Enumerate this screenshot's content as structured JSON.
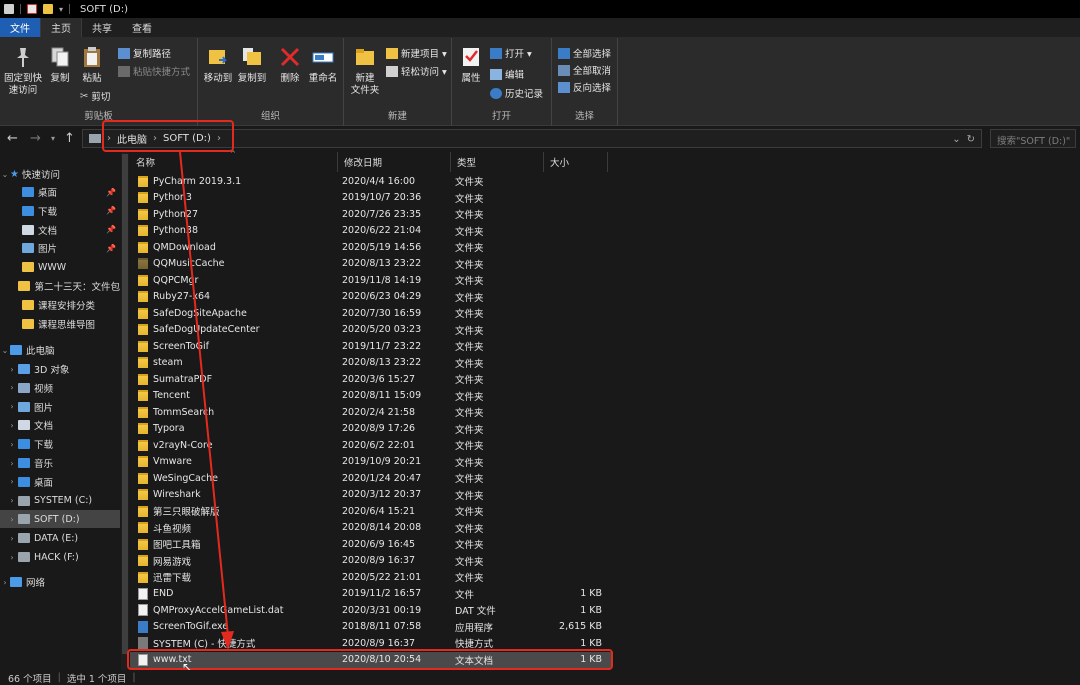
{
  "window": {
    "title": "SOFT (D:)"
  },
  "tabs": [
    {
      "label": "文件"
    },
    {
      "label": "主页"
    },
    {
      "label": "共享"
    },
    {
      "label": "查看"
    }
  ],
  "ribbon": {
    "clipboard": {
      "group_label": "剪贴板",
      "pin": "固定到快\n速访问",
      "copy": "复制",
      "paste": "粘贴",
      "copy_path": "复制路径",
      "paste_shortcut": "粘贴快捷方式",
      "cut": "剪切"
    },
    "organize": {
      "group_label": "组织",
      "move_to": "移动到",
      "copy_to": "复制到",
      "delete": "删除",
      "rename": "重命名"
    },
    "new": {
      "group_label": "新建",
      "new_folder": "新建\n文件夹",
      "new_item": "新建项目 ▾",
      "easy_access": "轻松访问 ▾"
    },
    "open": {
      "group_label": "打开",
      "properties": "属性",
      "open": "打开 ▾",
      "edit": "编辑",
      "history": "历史记录"
    },
    "select": {
      "group_label": "选择",
      "select_all": "全部选择",
      "select_none": "全部取消",
      "invert": "反向选择"
    }
  },
  "address": {
    "crumbs": [
      "此电脑",
      "SOFT (D:)"
    ],
    "search_placeholder": "搜索\"SOFT (D:)\""
  },
  "sidebar": {
    "quick_access": "快速访问",
    "quick_items": [
      {
        "label": "桌面",
        "icon": "desktop-icon",
        "color": "#3d8ee0",
        "pinned": true
      },
      {
        "label": "下载",
        "icon": "download-icon",
        "color": "#3d8ee0",
        "pinned": true
      },
      {
        "label": "文档",
        "icon": "document-icon",
        "color": "#cfd8e3",
        "pinned": true
      },
      {
        "label": "图片",
        "icon": "picture-icon",
        "color": "#6fa8dc",
        "pinned": true
      },
      {
        "label": "WWW",
        "icon": "folder-icon",
        "color": "#f0c243",
        "pinned": false
      },
      {
        "label": "第二十三天：文件包",
        "icon": "folder-icon",
        "color": "#f0c243",
        "pinned": false
      },
      {
        "label": "课程安排分类",
        "icon": "folder-icon",
        "color": "#f0c243",
        "pinned": false
      },
      {
        "label": "课程思维导图",
        "icon": "folder-icon",
        "color": "#f0c243",
        "pinned": false
      }
    ],
    "this_pc": "此电脑",
    "pc_items": [
      {
        "label": "3D 对象",
        "icon": "3d-objects-icon",
        "color": "#5aa0e6"
      },
      {
        "label": "视频",
        "icon": "video-icon",
        "color": "#8aa7c7"
      },
      {
        "label": "图片",
        "icon": "picture-icon",
        "color": "#6fa8dc"
      },
      {
        "label": "文档",
        "icon": "document-icon",
        "color": "#cfd8e3"
      },
      {
        "label": "下载",
        "icon": "download-icon",
        "color": "#3d8ee0"
      },
      {
        "label": "音乐",
        "icon": "music-icon",
        "color": "#3d8ee0"
      },
      {
        "label": "桌面",
        "icon": "desktop-icon",
        "color": "#3d8ee0"
      },
      {
        "label": "SYSTEM (C:)",
        "icon": "drive-icon",
        "color": "#9aa4ad"
      },
      {
        "label": "SOFT (D:)",
        "icon": "drive-icon",
        "color": "#9aa4ad",
        "selected": true
      },
      {
        "label": "DATA (E:)",
        "icon": "drive-icon",
        "color": "#9aa4ad"
      },
      {
        "label": "HACK (F:)",
        "icon": "drive-icon",
        "color": "#9aa4ad"
      }
    ],
    "network": "网络"
  },
  "columns": {
    "name": "名称",
    "date": "修改日期",
    "type": "类型",
    "size": "大小"
  },
  "files": [
    {
      "name": "PyCharm 2019.3.1",
      "date": "2020/4/4 16:00",
      "type": "文件夹",
      "size": "",
      "kind": "folder"
    },
    {
      "name": "Python3",
      "date": "2019/10/7 20:36",
      "type": "文件夹",
      "size": "",
      "kind": "folder"
    },
    {
      "name": "Python27",
      "date": "2020/7/26 23:35",
      "type": "文件夹",
      "size": "",
      "kind": "folder"
    },
    {
      "name": "Python38",
      "date": "2020/6/22 21:04",
      "type": "文件夹",
      "size": "",
      "kind": "folder"
    },
    {
      "name": "QMDownload",
      "date": "2020/5/19 14:56",
      "type": "文件夹",
      "size": "",
      "kind": "folder"
    },
    {
      "name": "QQMusicCache",
      "date": "2020/8/13 23:22",
      "type": "文件夹",
      "size": "",
      "kind": "folder-dark"
    },
    {
      "name": "QQPCMgr",
      "date": "2019/11/8 14:19",
      "type": "文件夹",
      "size": "",
      "kind": "folder"
    },
    {
      "name": "Ruby27-x64",
      "date": "2020/6/23 04:29",
      "type": "文件夹",
      "size": "",
      "kind": "folder"
    },
    {
      "name": "SafeDogSiteApache",
      "date": "2020/7/30 16:59",
      "type": "文件夹",
      "size": "",
      "kind": "folder"
    },
    {
      "name": "SafeDogUpdateCenter",
      "date": "2020/5/20 03:23",
      "type": "文件夹",
      "size": "",
      "kind": "folder"
    },
    {
      "name": "ScreenToGif",
      "date": "2019/11/7 23:22",
      "type": "文件夹",
      "size": "",
      "kind": "folder"
    },
    {
      "name": "steam",
      "date": "2020/8/13 23:22",
      "type": "文件夹",
      "size": "",
      "kind": "folder"
    },
    {
      "name": "SumatraPDF",
      "date": "2020/3/6 15:27",
      "type": "文件夹",
      "size": "",
      "kind": "folder"
    },
    {
      "name": "Tencent",
      "date": "2020/8/11 15:09",
      "type": "文件夹",
      "size": "",
      "kind": "folder"
    },
    {
      "name": "TommSearch",
      "date": "2020/2/4 21:58",
      "type": "文件夹",
      "size": "",
      "kind": "folder"
    },
    {
      "name": "Typora",
      "date": "2020/8/9 17:26",
      "type": "文件夹",
      "size": "",
      "kind": "folder"
    },
    {
      "name": "v2rayN-Core",
      "date": "2020/6/2 22:01",
      "type": "文件夹",
      "size": "",
      "kind": "folder"
    },
    {
      "name": "Vmware",
      "date": "2019/10/9 20:21",
      "type": "文件夹",
      "size": "",
      "kind": "folder"
    },
    {
      "name": "WeSingCache",
      "date": "2020/1/24 20:47",
      "type": "文件夹",
      "size": "",
      "kind": "folder"
    },
    {
      "name": "Wireshark",
      "date": "2020/3/12 20:37",
      "type": "文件夹",
      "size": "",
      "kind": "folder"
    },
    {
      "name": "第三只眼破解版",
      "date": "2020/6/4 15:21",
      "type": "文件夹",
      "size": "",
      "kind": "folder"
    },
    {
      "name": "斗鱼视频",
      "date": "2020/8/14 20:08",
      "type": "文件夹",
      "size": "",
      "kind": "folder"
    },
    {
      "name": "图吧工具箱",
      "date": "2020/6/9 16:45",
      "type": "文件夹",
      "size": "",
      "kind": "folder"
    },
    {
      "name": "网易游戏",
      "date": "2020/8/9 16:37",
      "type": "文件夹",
      "size": "",
      "kind": "folder"
    },
    {
      "name": "迅雷下载",
      "date": "2020/5/22 21:01",
      "type": "文件夹",
      "size": "",
      "kind": "folder"
    },
    {
      "name": "END",
      "date": "2019/11/2 16:57",
      "type": "文件",
      "size": "1 KB",
      "kind": "file"
    },
    {
      "name": "QMProxyAccelGameList.dat",
      "date": "2020/3/31 00:19",
      "type": "DAT 文件",
      "size": "1 KB",
      "kind": "file"
    },
    {
      "name": "ScreenToGif.exe",
      "date": "2018/8/11 07:58",
      "type": "应用程序",
      "size": "2,615 KB",
      "kind": "exe"
    },
    {
      "name": "SYSTEM (C) - 快捷方式",
      "date": "2020/8/9 16:37",
      "type": "快捷方式",
      "size": "1 KB",
      "kind": "lnk"
    },
    {
      "name": "www.txt",
      "date": "2020/8/10 20:54",
      "type": "文本文档",
      "size": "1 KB",
      "kind": "file",
      "selected": true
    }
  ],
  "status": {
    "count": "66 个项目",
    "selected": "选中 1 个项目"
  },
  "colors": {
    "accent": "#1e5fb4",
    "highlight": "#e42a1e",
    "folder": "#f0c243"
  }
}
